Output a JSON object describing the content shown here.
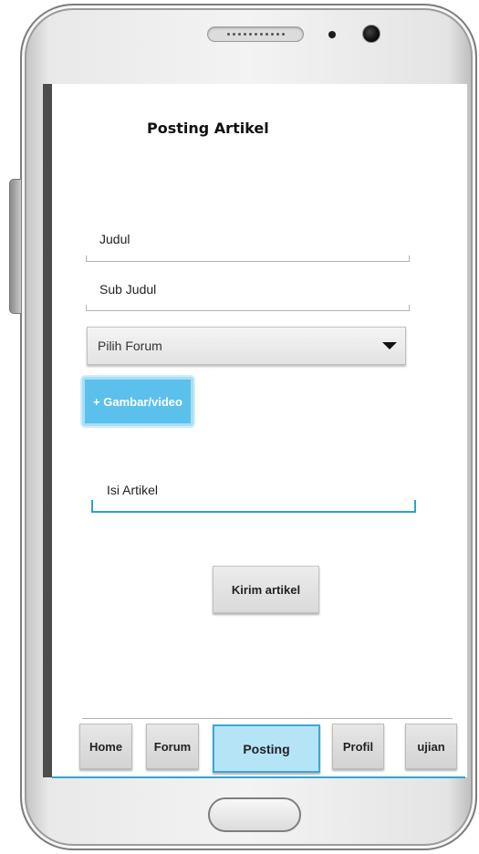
{
  "screen": {
    "title": "Posting Artikel"
  },
  "form": {
    "title_placeholder": "Judul",
    "subtitle_placeholder": "Sub Judul",
    "forum_select_value": "Pilih Forum",
    "media_button_label": "+ Gambar/video",
    "article_placeholder": "Isi Artikel",
    "submit_label": "Kirim artikel"
  },
  "nav": {
    "items": [
      {
        "label": "Home"
      },
      {
        "label": "Forum"
      },
      {
        "label": "Posting"
      },
      {
        "label": "Profil"
      },
      {
        "label": "ujian"
      }
    ],
    "active": "Posting"
  },
  "colors": {
    "accent": "#2fa6d4",
    "media_button": "#5cc0ec",
    "active_tab": "#b6e4f7"
  },
  "icons": {
    "dropdown": "caret-down-icon"
  }
}
